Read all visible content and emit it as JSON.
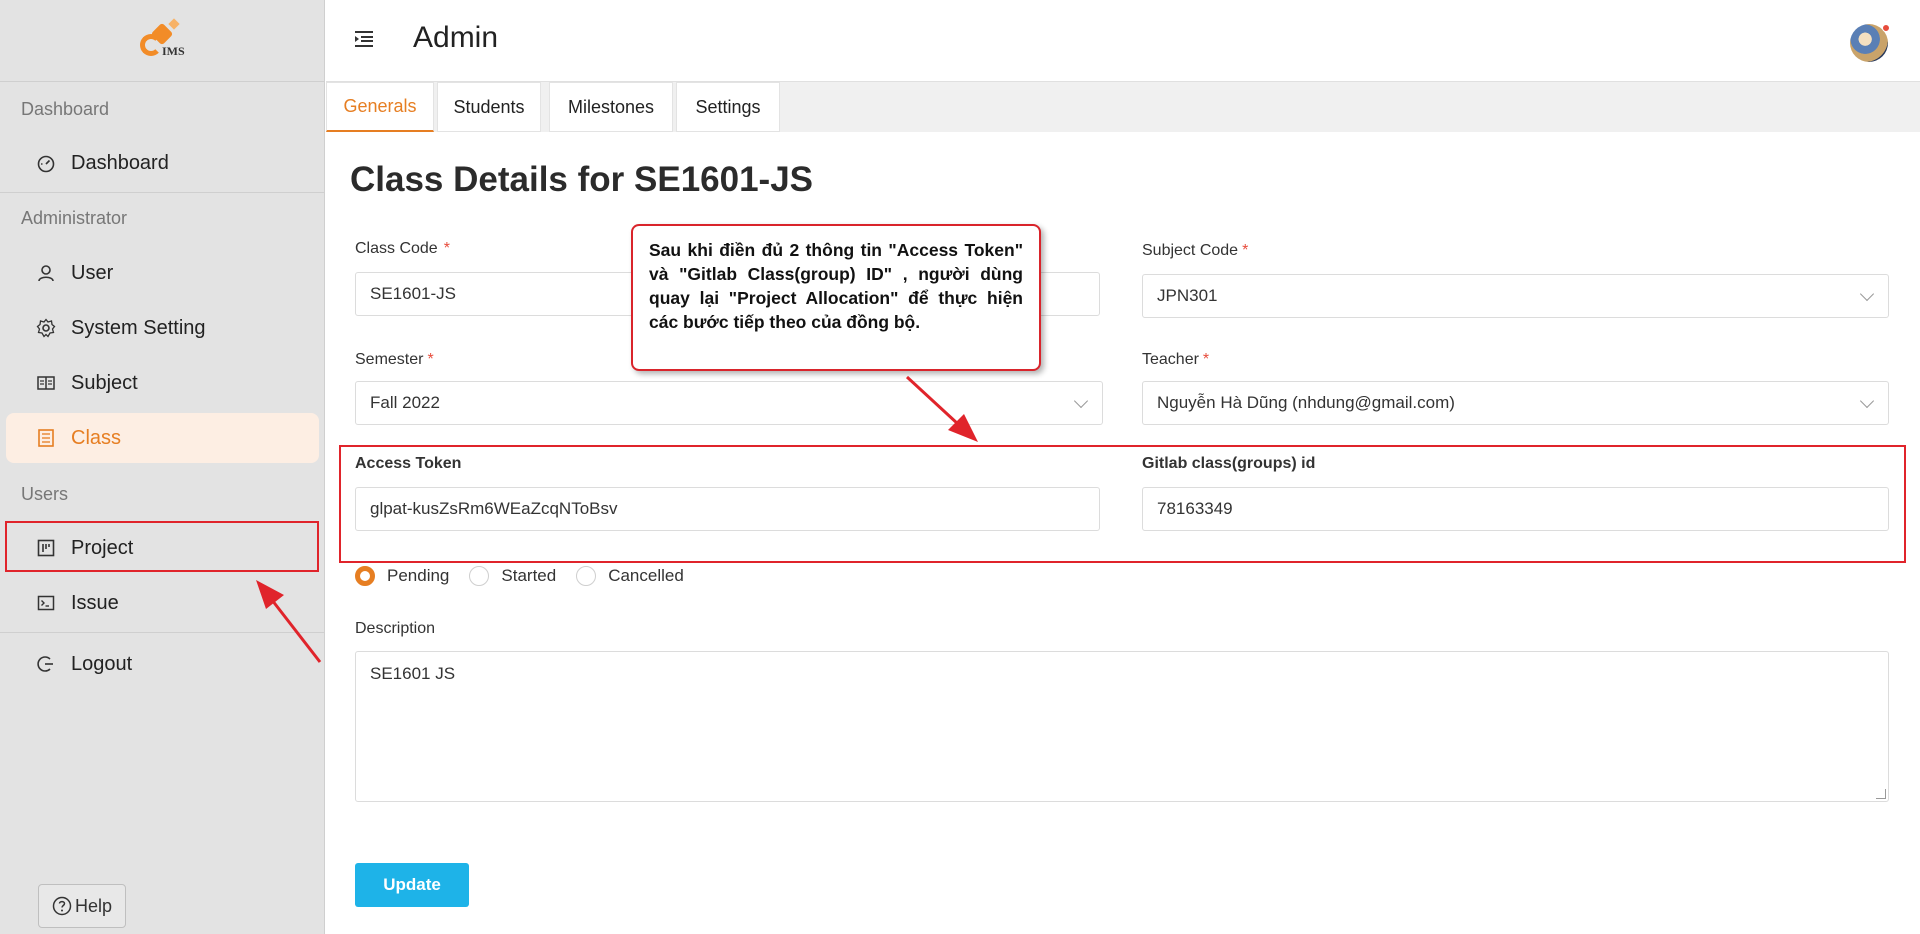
{
  "app": {
    "logo_text": "IMS",
    "header_title": "Admin"
  },
  "sidebar": {
    "groups": {
      "dashboard": "Dashboard",
      "administrator": "Administrator",
      "users": "Users"
    },
    "items": [
      {
        "label": "Dashboard",
        "icon": "dashboard-icon"
      },
      {
        "label": "User",
        "icon": "user-icon"
      },
      {
        "label": "System Setting",
        "icon": "gear-icon"
      },
      {
        "label": "Subject",
        "icon": "book-icon"
      },
      {
        "label": "Class",
        "icon": "class-icon",
        "active": true
      },
      {
        "label": "Project",
        "icon": "project-icon"
      },
      {
        "label": "Issue",
        "icon": "terminal-icon"
      },
      {
        "label": "Logout",
        "icon": "logout-icon"
      }
    ],
    "help_label": "Help"
  },
  "tabs": [
    "Generals",
    "Students",
    "Milestones",
    "Settings"
  ],
  "form": {
    "title": "Class Details for SE1601-JS",
    "class_code": {
      "label": "Class Code",
      "required": "*",
      "value": "SE1601-JS"
    },
    "subject_code": {
      "label": "Subject Code",
      "required": "*",
      "value": "JPN301"
    },
    "semester": {
      "label": "Semester",
      "required": "*",
      "value": "Fall 2022"
    },
    "teacher": {
      "label": "Teacher",
      "required": "*",
      "value": "Nguyễn Hà Dũng (nhdung@gmail.com)"
    },
    "access_token": {
      "label": "Access Token",
      "value": "glpat-kusZsRm6WEaZcqNToBsv"
    },
    "gitlab_id": {
      "label": "Gitlab class(groups) id",
      "value": "78163349"
    },
    "status_options": [
      {
        "label": "Pending",
        "checked": true
      },
      {
        "label": "Started",
        "checked": false
      },
      {
        "label": "Cancelled",
        "checked": false
      }
    ],
    "description": {
      "label": "Description",
      "value": "SE1601 JS"
    },
    "update_label": "Update"
  },
  "callout": {
    "text": "Sau khi điền đủ 2 thông tin \"Access Token\" và \"Gitlab Class(group) ID\" , người dùng quay lại \"Project Allocation\" để thực hiện các bước tiếp theo của đồng bộ."
  },
  "colors": {
    "accent": "#e67e22",
    "primary_button": "#1eb3e8",
    "annotation_red": "#e0242b"
  }
}
